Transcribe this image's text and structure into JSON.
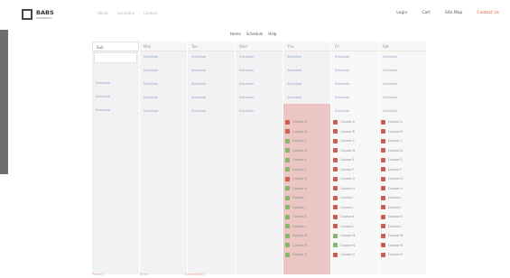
{
  "header": {
    "logo_text": "BABS",
    "logo_subtext": "UNIVERSITY",
    "links": [
      "About",
      "Locations",
      "Contact"
    ],
    "right_links": [
      "Login",
      "Cart",
      "Site Map",
      "Contact Us"
    ]
  },
  "subtabs": [
    "Home",
    "Schedule",
    "Help"
  ],
  "columns": [
    {
      "header": "Sub",
      "active": true,
      "rows": [
        "",
        "",
        "Schedule",
        "Schedule",
        "Schedule"
      ]
    },
    {
      "header": "Mon",
      "rows": [
        "Schedule",
        "Schedule",
        "Schedule",
        "Schedule",
        "Schedule"
      ]
    },
    {
      "header": "Tue",
      "rows": [
        "Schedule",
        "Schedule",
        "Schedule",
        "Schedule",
        "Schedule"
      ]
    },
    {
      "header": "Wed",
      "rows": [
        "Schedule",
        "Schedule",
        "Schedule",
        "Schedule",
        "Schedule"
      ]
    },
    {
      "header": "Thu",
      "rows": [
        "Schedule",
        "Schedule",
        "Schedule",
        "Schedule",
        "Schedule"
      ]
    },
    {
      "header": "Fri",
      "rows": [
        "Schedule",
        "Schedule",
        "Schedule",
        "Schedule",
        "Schedule"
      ]
    },
    {
      "header": "Sat",
      "rows": [
        "Schedule",
        "Schedule",
        "Schedule",
        "Schedule",
        "Schedule"
      ]
    }
  ],
  "list_col1": [
    {
      "label": "Course A",
      "status": "r"
    },
    {
      "label": "Course B",
      "status": "r"
    },
    {
      "label": "Course C",
      "status": "g"
    },
    {
      "label": "Course D",
      "status": "g"
    },
    {
      "label": "Course E",
      "status": "g"
    },
    {
      "label": "Course F",
      "status": "g"
    },
    {
      "label": "Course G",
      "status": "r"
    },
    {
      "label": "Course H",
      "status": "g"
    },
    {
      "label": "Course I",
      "status": "g"
    },
    {
      "label": "Course J",
      "status": "g"
    },
    {
      "label": "Course K",
      "status": "g"
    },
    {
      "label": "Course L",
      "status": "g"
    },
    {
      "label": "Course M",
      "status": "g"
    },
    {
      "label": "Course N",
      "status": "g"
    },
    {
      "label": "Course O",
      "status": "g"
    }
  ],
  "list_col2": [
    {
      "label": "Course A",
      "status": "r"
    },
    {
      "label": "Course B",
      "status": "r"
    },
    {
      "label": "Course C",
      "status": "r"
    },
    {
      "label": "Course D",
      "status": "r"
    },
    {
      "label": "Course E",
      "status": "r"
    },
    {
      "label": "Course F",
      "status": "r"
    },
    {
      "label": "Course G",
      "status": "r"
    },
    {
      "label": "Course H",
      "status": "r"
    },
    {
      "label": "Course I",
      "status": "r"
    },
    {
      "label": "Course J",
      "status": "r"
    },
    {
      "label": "Course K",
      "status": "r"
    },
    {
      "label": "Course L",
      "status": "r"
    },
    {
      "label": "Course M",
      "status": "g"
    },
    {
      "label": "Course N",
      "status": "g"
    },
    {
      "label": "Course O",
      "status": "r"
    }
  ],
  "list_col3": [
    {
      "label": "Course A",
      "status": "r"
    },
    {
      "label": "Course B",
      "status": "r"
    },
    {
      "label": "Course C",
      "status": "r"
    },
    {
      "label": "Course D",
      "status": "r"
    },
    {
      "label": "Course E",
      "status": "r"
    },
    {
      "label": "Course F",
      "status": "r"
    },
    {
      "label": "Course G",
      "status": "r"
    },
    {
      "label": "Course H",
      "status": "r"
    },
    {
      "label": "Course I",
      "status": "r"
    },
    {
      "label": "Course J",
      "status": "r"
    },
    {
      "label": "Course K",
      "status": "r"
    },
    {
      "label": "Course L",
      "status": "r"
    },
    {
      "label": "Course M",
      "status": "r"
    },
    {
      "label": "Course N",
      "status": "r"
    },
    {
      "label": "Course O",
      "status": "r"
    }
  ],
  "footer_links": [
    "Privacy",
    "Terms",
    "Accessibility"
  ],
  "colors": {
    "accent": "#e0552b",
    "pink": "#ecc5c5",
    "green": "#86b66a",
    "red": "#cc5b55"
  }
}
